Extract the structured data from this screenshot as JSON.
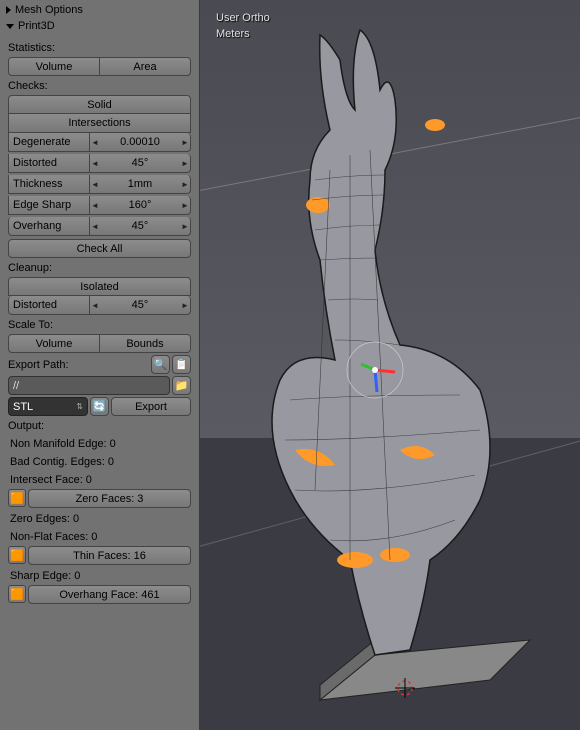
{
  "panels": {
    "meshOptions": "Mesh Options",
    "print3d": "Print3D"
  },
  "statistics": {
    "label": "Statistics:",
    "volume": "Volume",
    "area": "Area"
  },
  "checks": {
    "label": "Checks:",
    "solid": "Solid",
    "intersections": "Intersections",
    "degenerate": {
      "label": "Degenerate",
      "value": "0.00010"
    },
    "distorted": {
      "label": "Distorted",
      "value": "45°"
    },
    "thickness": {
      "label": "Thickness",
      "value": "1mm"
    },
    "edgeSharp": {
      "label": "Edge Sharp",
      "value": "160°"
    },
    "overhang": {
      "label": "Overhang",
      "value": "45°"
    },
    "checkAll": "Check All"
  },
  "cleanup": {
    "label": "Cleanup:",
    "isolated": "Isolated",
    "distorted": {
      "label": "Distorted",
      "value": "45°"
    }
  },
  "scaleTo": {
    "label": "Scale To:",
    "volume": "Volume",
    "bounds": "Bounds"
  },
  "export": {
    "pathLabel": "Export Path:",
    "path": "//",
    "format": "STL",
    "exportBtn": "Export"
  },
  "output": {
    "label": "Output:",
    "nonManifoldEdge": "Non Manifold Edge: 0",
    "badContigEdges": "Bad Contig. Edges: 0",
    "intersectFace": "Intersect Face: 0",
    "zeroFaces": "Zero Faces: 3",
    "zeroEdges": "Zero Edges: 0",
    "nonFlatFaces": "Non-Flat Faces: 0",
    "thinFaces": "Thin Faces: 16",
    "sharpEdge": "Sharp Edge: 0",
    "overhangFace": "Overhang Face: 461"
  },
  "viewport": {
    "projection": "User Ortho",
    "units": "Meters"
  },
  "icons": {
    "zoom": "🔍",
    "copy": "📋",
    "folder": "📁",
    "reload": "🔄",
    "cube": "🟧"
  }
}
